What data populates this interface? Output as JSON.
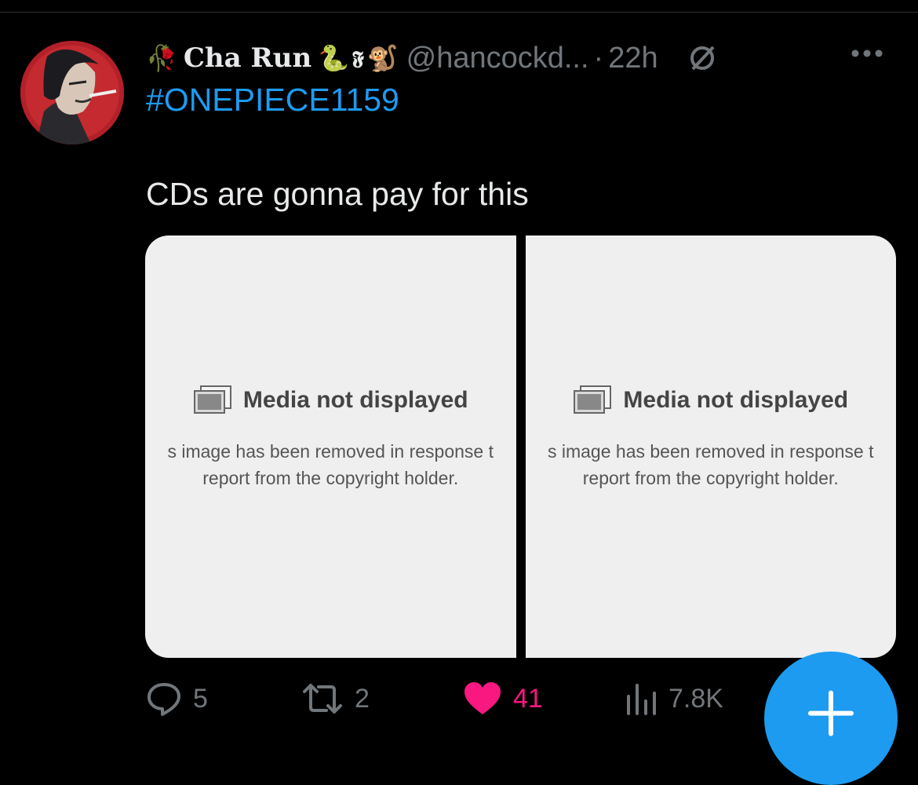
{
  "tweet": {
    "display_name": "Cha Run",
    "name_emojis_left": [
      "🥀"
    ],
    "name_emojis_right": [
      "🐍",
      "𝕱",
      "🐒"
    ],
    "handle": "@hancockd...",
    "separator": "·",
    "time": "22h",
    "hashtag": "#ONEPIECE1159",
    "text": "CDs are gonna pay for this"
  },
  "media": [
    {
      "title": "Media not displayed",
      "line1": "s image has been removed in response t",
      "line2": "report from the copyright holder."
    },
    {
      "title": "Media not displayed",
      "line1": "s image has been removed in response t",
      "line2": "report from the copyright holder."
    }
  ],
  "actions": {
    "replies": "5",
    "retweets": "2",
    "likes": "41",
    "views": "7.8K"
  },
  "colors": {
    "accent": "#1d9bf0",
    "like": "#f91880",
    "muted": "#71767b"
  },
  "icons": {
    "reply": "reply-icon",
    "retweet": "retweet-icon",
    "like": "heart-icon",
    "views": "views-icon",
    "more": "more-icon",
    "null": "null-icon",
    "compose": "plus-icon"
  }
}
